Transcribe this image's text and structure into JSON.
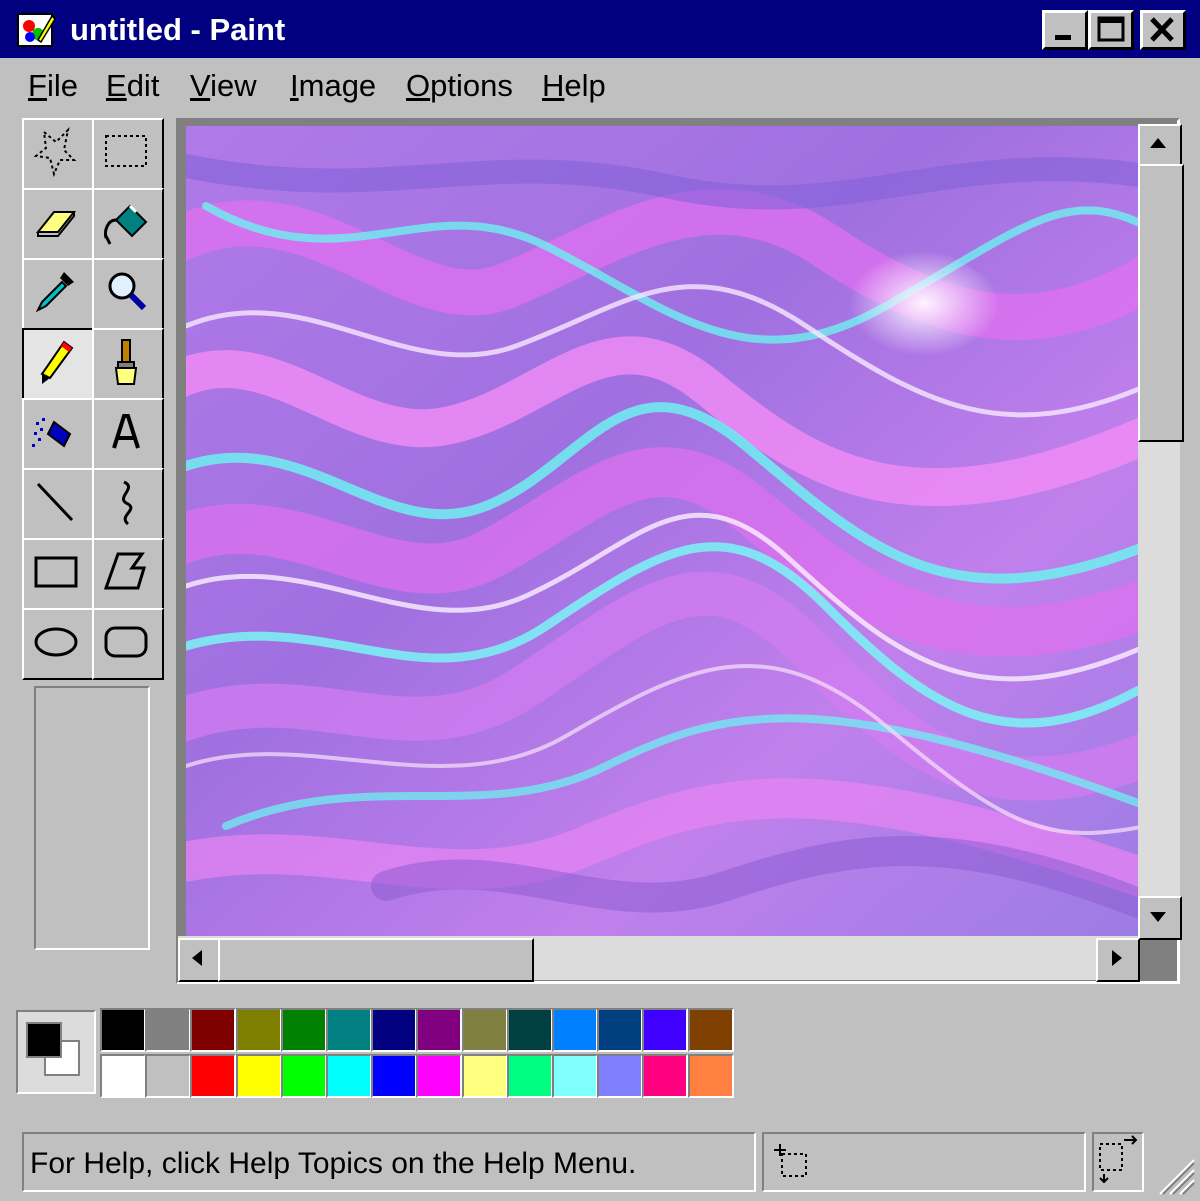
{
  "window": {
    "title": "untitled - Paint",
    "app_icon": "paint-icon",
    "controls": [
      "minimize-icon",
      "maximize-icon",
      "close-icon"
    ]
  },
  "menu": [
    {
      "label": "File",
      "mnemonic": "F",
      "rest": "ile"
    },
    {
      "label": "Edit",
      "mnemonic": "E",
      "rest": "dit"
    },
    {
      "label": "View",
      "mnemonic": "V",
      "rest": "iew"
    },
    {
      "label": "Image",
      "mnemonic": "I",
      "rest": "mage"
    },
    {
      "label": "Options",
      "mnemonic": "O",
      "rest": "ptions"
    },
    {
      "label": "Help",
      "mnemonic": "H",
      "rest": "elp"
    }
  ],
  "tools": [
    {
      "name": "free-form-select",
      "icon": "free-form-select-icon",
      "selected": false
    },
    {
      "name": "select",
      "icon": "rectangle-select-icon",
      "selected": false
    },
    {
      "name": "eraser",
      "icon": "eraser-icon",
      "selected": false
    },
    {
      "name": "fill-with-color",
      "icon": "paint-bucket-icon",
      "selected": false
    },
    {
      "name": "pick-color",
      "icon": "eyedropper-icon",
      "selected": false
    },
    {
      "name": "magnifier",
      "icon": "magnifier-icon",
      "selected": false
    },
    {
      "name": "pencil",
      "icon": "pencil-icon",
      "selected": true
    },
    {
      "name": "brush",
      "icon": "brush-icon",
      "selected": false
    },
    {
      "name": "airbrush",
      "icon": "airbrush-icon",
      "selected": false
    },
    {
      "name": "text",
      "icon": "text-icon",
      "selected": false
    },
    {
      "name": "line",
      "icon": "line-icon",
      "selected": false
    },
    {
      "name": "curve",
      "icon": "curve-icon",
      "selected": false
    },
    {
      "name": "rectangle",
      "icon": "rectangle-icon",
      "selected": false
    },
    {
      "name": "polygon",
      "icon": "polygon-icon",
      "selected": false
    },
    {
      "name": "ellipse",
      "icon": "ellipse-icon",
      "selected": false
    },
    {
      "name": "rounded-rectangle",
      "icon": "rounded-rectangle-icon",
      "selected": false
    }
  ],
  "canvas": {
    "image": "holographic-marble-artwork",
    "colors": {
      "violet": "#9a6ee0",
      "magenta": "#e070f0",
      "cyan": "#6ef0f0",
      "pale": "#f4dcfa"
    }
  },
  "palette": {
    "foreground": "#000000",
    "background": "#ffffff",
    "top_row": [
      "#000000",
      "#808080",
      "#800000",
      "#808000",
      "#008000",
      "#008080",
      "#000080",
      "#800080",
      "#808040",
      "#004040",
      "#0080ff",
      "#004080",
      "#4000ff",
      "#804000"
    ],
    "bottom_row": [
      "#ffffff",
      "#c0c0c0",
      "#ff0000",
      "#ffff00",
      "#00ff00",
      "#00ffff",
      "#0000ff",
      "#ff00ff",
      "#ffff80",
      "#00ff80",
      "#80ffff",
      "#8080ff",
      "#ff0080",
      "#ff8040"
    ]
  },
  "status": {
    "help_text": "For Help, click Help Topics on the Help Menu.",
    "position_icon": "cursor-position-icon",
    "size_icon": "selection-size-icon"
  },
  "scrollbars": {
    "vertical_position": 0.0,
    "vertical_visible_fraction": 0.37,
    "horizontal_position": 0.0,
    "horizontal_visible_fraction": 0.34
  }
}
